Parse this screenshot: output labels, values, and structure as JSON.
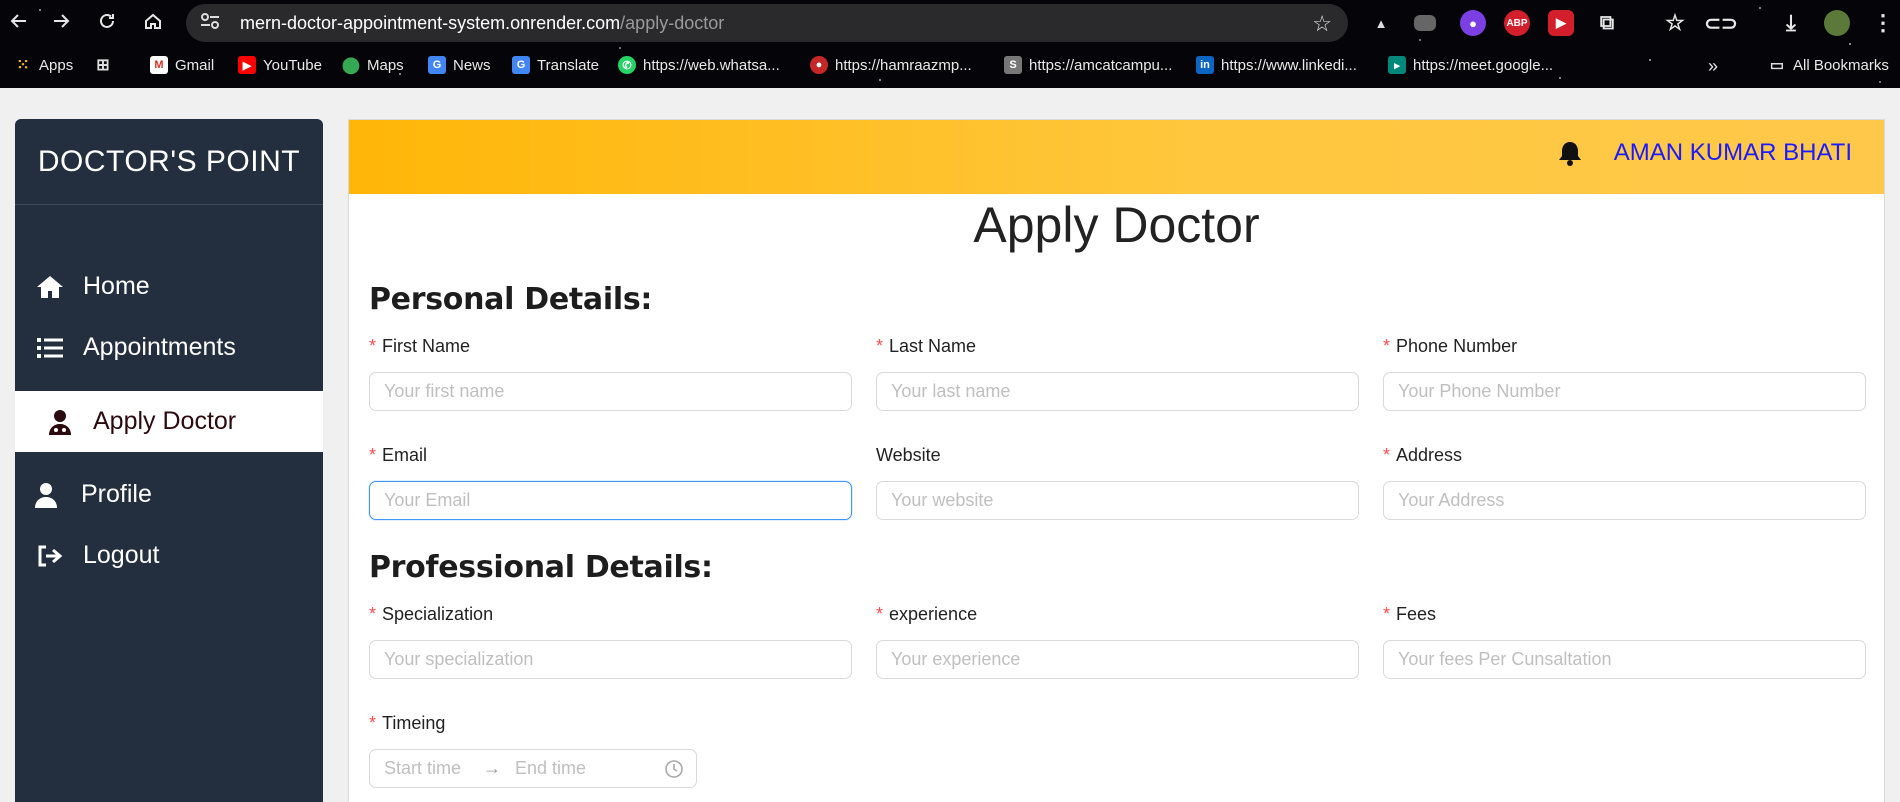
{
  "browser": {
    "url_host": "mern-doctor-appointment-system.onrender.com",
    "url_path": "/apply-doctor",
    "bookmarks": [
      {
        "label": "Apps",
        "icon": "apps-grid-icon"
      },
      {
        "label": "",
        "icon": "grid-icon"
      },
      {
        "label": "Gmail",
        "icon": "gmail-icon"
      },
      {
        "label": "YouTube",
        "icon": "youtube-icon"
      },
      {
        "label": "Maps",
        "icon": "maps-icon"
      },
      {
        "label": "News",
        "icon": "news-icon"
      },
      {
        "label": "Translate",
        "icon": "translate-icon"
      },
      {
        "label": "https://web.whatsa...",
        "icon": "whatsapp-icon"
      },
      {
        "label": "https://hamraazmp...",
        "icon": "hamraaz-icon"
      },
      {
        "label": "https://amcatcampu...",
        "icon": "amcat-icon"
      },
      {
        "label": "https://www.linkedi...",
        "icon": "linkedin-icon"
      },
      {
        "label": "https://meet.google...",
        "icon": "meet-icon"
      }
    ],
    "all_bookmarks": "All Bookmarks"
  },
  "sidebar": {
    "brand": "DOCTOR'S POINT",
    "items": [
      {
        "label": "Home",
        "icon": "home-icon"
      },
      {
        "label": "Appointments",
        "icon": "list-icon"
      },
      {
        "label": "Apply Doctor",
        "icon": "doctor-icon",
        "active": true
      },
      {
        "label": "Profile",
        "icon": "user-icon"
      },
      {
        "label": "Logout",
        "icon": "logout-icon"
      }
    ]
  },
  "header": {
    "user_name": "AMAN KUMAR BHATI"
  },
  "page": {
    "title": "Apply Doctor",
    "personal_title": "Personal Details:",
    "professional_title": "Professional Details:"
  },
  "fields": {
    "first_name": {
      "label": "First Name",
      "placeholder": "Your first name",
      "value": "",
      "required": true
    },
    "last_name": {
      "label": "Last Name",
      "placeholder": "Your last name",
      "value": "",
      "required": true
    },
    "phone": {
      "label": "Phone Number",
      "placeholder": "Your Phone Number",
      "value": "",
      "required": true
    },
    "email": {
      "label": "Email",
      "placeholder": "Your Email",
      "value": "",
      "required": true
    },
    "website": {
      "label": "Website",
      "placeholder": "Your website",
      "value": "",
      "required": false
    },
    "address": {
      "label": "Address",
      "placeholder": "Your Address",
      "value": "",
      "required": true
    },
    "specialization": {
      "label": "Specialization",
      "placeholder": "Your specialization",
      "value": "",
      "required": true
    },
    "experience": {
      "label": "experience",
      "placeholder": "Your experience",
      "value": "",
      "required": true
    },
    "fees": {
      "label": "Fees",
      "placeholder": "Your fees Per Cunsaltation",
      "value": "",
      "required": true
    },
    "timing": {
      "label": "Timeing",
      "start_placeholder": "Start time",
      "end_placeholder": "End time",
      "required": true
    }
  },
  "colors": {
    "sidebar_bg": "#232f3e",
    "header_gradient_start": "#ffb607",
    "header_gradient_end": "#ffc84a",
    "username": "#1a1aff",
    "required_mark": "#ff4d4f",
    "focus_border": "#4096ff"
  }
}
